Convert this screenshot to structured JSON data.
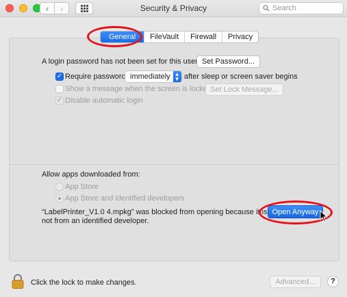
{
  "window": {
    "title": "Security & Privacy"
  },
  "search": {
    "placeholder": "Search"
  },
  "tabs": [
    "General",
    "FileVault",
    "Firewall",
    "Privacy"
  ],
  "general": {
    "login_password_text": "A login password has not been set for this user",
    "set_password_label": "Set Password...",
    "require_password": {
      "label": "Require password",
      "checked": true,
      "select_value": "immediately",
      "suffix": "after sleep or screen saver begins"
    },
    "show_message": {
      "label": "Show a message when the screen is locked",
      "checked": false,
      "enabled": false,
      "button_label": "Set Lock Message..."
    },
    "disable_auto_login": {
      "label": "Disable automatic login",
      "checked": true,
      "enabled": false
    }
  },
  "apps": {
    "heading": "Allow apps downloaded from:",
    "options": [
      {
        "label": "App Store",
        "selected": false
      },
      {
        "label": "App Store and identified developers",
        "selected": true
      }
    ],
    "blocked_line1": "“LabelPrinter_V1.0 4.mpkg” was blocked from opening because it is",
    "blocked_line2": "not from an identified developer.",
    "open_anyway_label": "Open Anyway"
  },
  "footer": {
    "lock_text": "Click the lock to make changes.",
    "advanced_label": "Advanced...",
    "help_label": "?"
  },
  "colors": {
    "accent": "#1a6ce8",
    "annotation": "#e1131b"
  },
  "icons": [
    "chevron-left-icon",
    "chevron-right-icon",
    "grid-icon",
    "search-icon",
    "lock-icon",
    "help-icon"
  ]
}
